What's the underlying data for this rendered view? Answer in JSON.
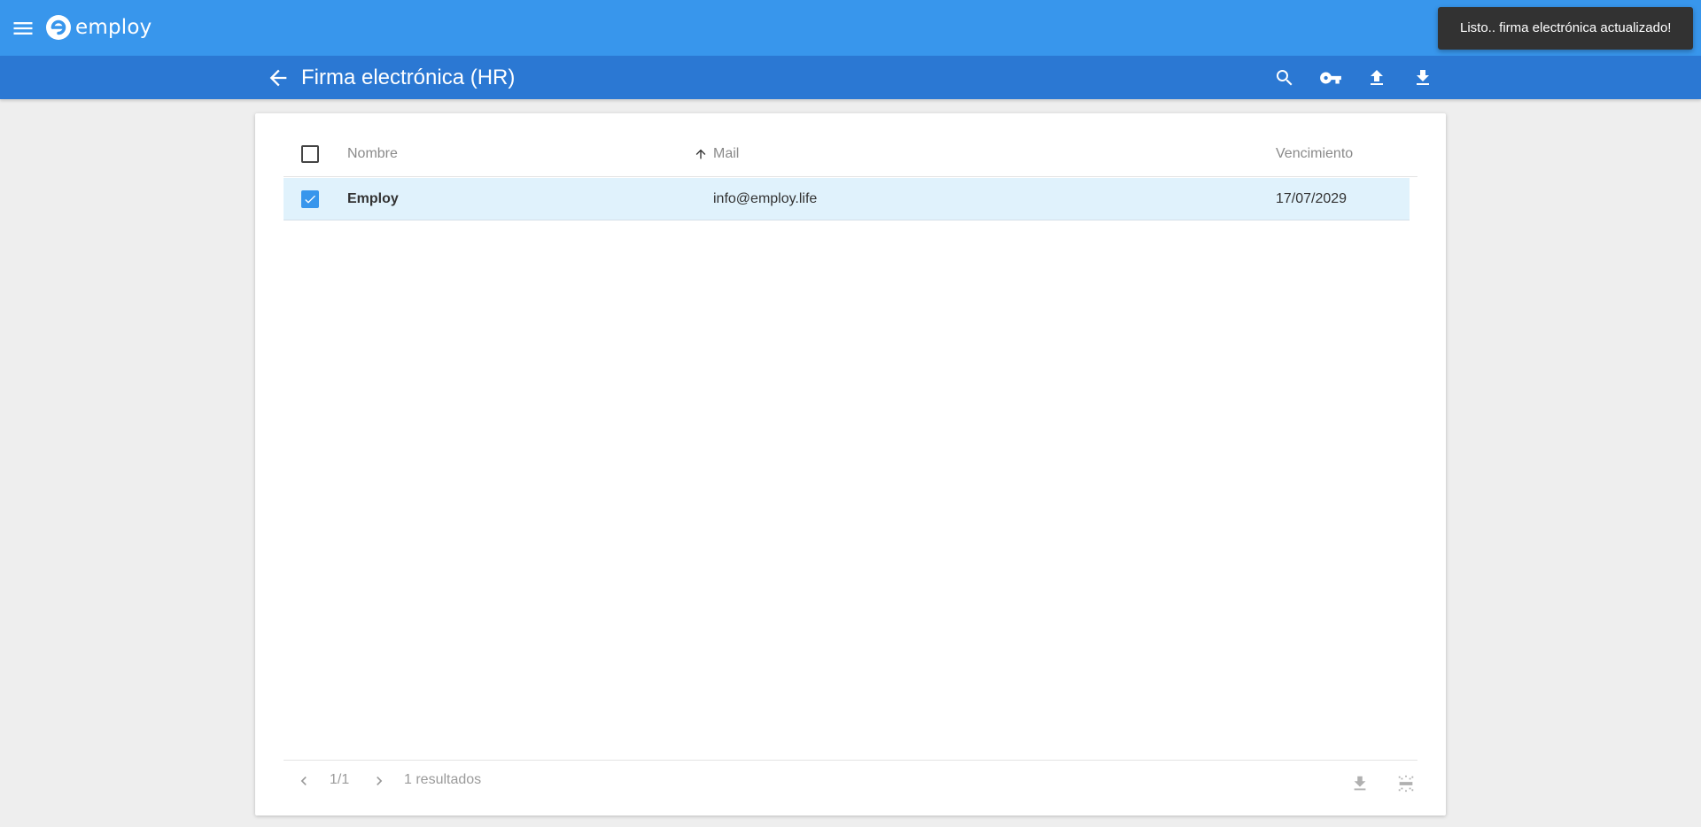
{
  "app": {
    "brand": "employ",
    "accent_color": "#3896ec",
    "subbar_color": "#2b78d3"
  },
  "header": {
    "title": "Firma electrónica (HR)",
    "icons": [
      "menu-icon",
      "back-arrow-icon",
      "search-icon",
      "key-icon",
      "upload-icon",
      "download-icon"
    ]
  },
  "snackbar": {
    "message": "Listo.. firma electrónica actualizado!"
  },
  "table": {
    "columns": [
      "Nombre",
      "Mail",
      "Vencimiento"
    ],
    "sorted_column": "Mail",
    "sort_direction": "ascending",
    "rows": [
      {
        "name": "Employ",
        "mail": "info@employ.life",
        "expiry": "17/07/2029",
        "selected": true
      }
    ]
  },
  "pagination": {
    "page": "1/1",
    "results": "1 resultados"
  }
}
